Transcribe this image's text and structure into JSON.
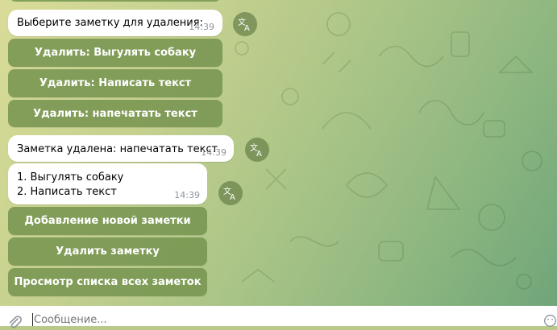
{
  "messages": {
    "m1": {
      "text": "Выберите заметку для удаления:",
      "time": "14:39"
    },
    "m2": {
      "text": "Заметка удалена: напечатать текст",
      "time": "14:39"
    },
    "m3": {
      "line1": "1. Выгулять собаку",
      "line2": "2. Написать текст",
      "time": "14:39"
    }
  },
  "keyboard1": {
    "buttons": [
      "Удалить: Выгулять собаку",
      "Удалить: Написать текст",
      "Удалить: напечатать текст"
    ]
  },
  "keyboard2": {
    "buttons": [
      "Добавление новой заметки",
      "Удалить заметку",
      "Просмотр списка всех заметок"
    ]
  },
  "input": {
    "placeholder": "Сообщение..."
  },
  "icons": {
    "translate": "translate-icon",
    "attach": "paperclip-icon",
    "emoji": "emoji-icon"
  },
  "colors": {
    "keyboard_button": "#76944f",
    "bubble": "#ffffff",
    "time": "#8d959c"
  }
}
